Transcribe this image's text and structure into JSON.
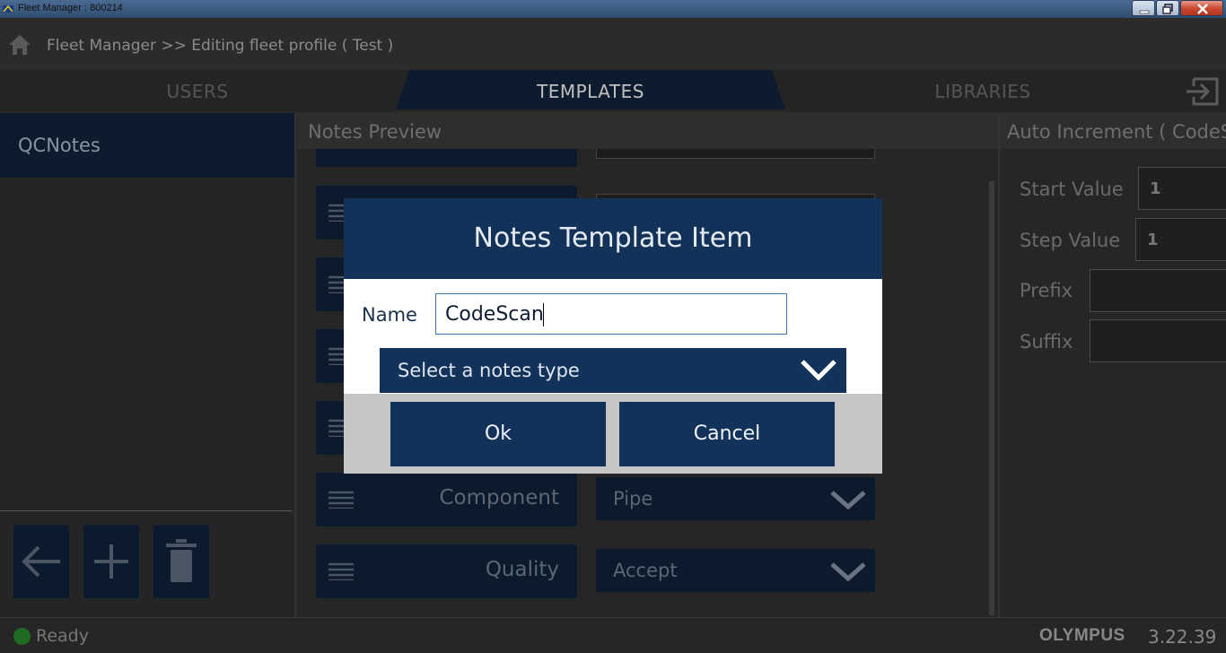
{
  "window": {
    "title": "Fleet Manager : 800214"
  },
  "header": {
    "breadcrumb": "Fleet Manager >> Editing fleet profile ( Test )"
  },
  "tabs": [
    {
      "label": "USERS",
      "active": false
    },
    {
      "label": "TEMPLATES",
      "active": true
    },
    {
      "label": "LIBRARIES",
      "active": false
    }
  ],
  "left_panel": {
    "selected_item": "QCNotes"
  },
  "preview": {
    "title": "Notes Preview",
    "rows": [
      {
        "label": "Component",
        "value": "Pipe"
      },
      {
        "label": "Quality",
        "value": "Accept"
      }
    ]
  },
  "right_panel": {
    "title": "Auto Increment ( CodeScan )",
    "start_label": "Start Value",
    "start_value": "1",
    "step_label": "Step Value",
    "step_value": "1",
    "prefix_label": "Prefix",
    "suffix_label": "Suffix"
  },
  "dialog": {
    "title": "Notes Template Item",
    "name_label": "Name",
    "name_value": "CodeScan",
    "select_placeholder": "Select a notes type",
    "ok_label": "Ok",
    "cancel_label": "Cancel"
  },
  "statusbar": {
    "status": "Ready",
    "brand": "OLYMPUS",
    "version": "3.22.39"
  },
  "colors": {
    "dialog_header": "#12325a",
    "dark_button": "#0c1a2d",
    "status_ok": "#1f6b22"
  }
}
